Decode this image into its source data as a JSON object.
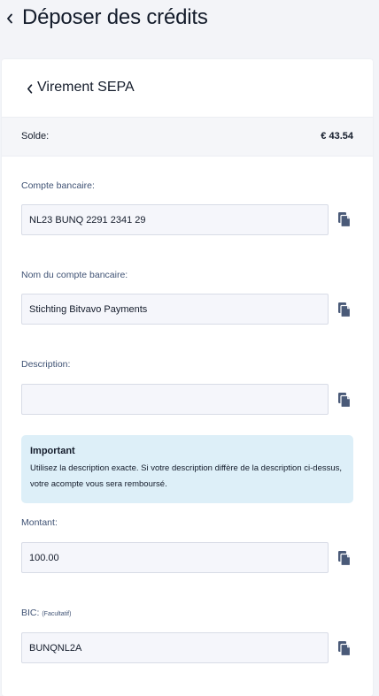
{
  "page": {
    "title": "Déposer des crédits"
  },
  "card": {
    "title": "Virement SEPA"
  },
  "balance": {
    "label": "Solde:",
    "value": "€ 43.54"
  },
  "fields": {
    "iban": {
      "label": "Compte bancaire:",
      "value": "NL23 BUNQ 2291 2341 29"
    },
    "account_name": {
      "label": "Nom du compte bancaire:",
      "value": "Stichting Bitvavo Payments"
    },
    "description": {
      "label": "Description:",
      "value": ""
    },
    "amount": {
      "label": "Montant:",
      "value": "100.00"
    },
    "bic": {
      "label": "BIC:",
      "optional_note": "(Facultatif)",
      "value": "BUNQNL2A"
    }
  },
  "notice": {
    "title": "Important",
    "text": "Utilisez la description exacte. Si votre description diffère de la description ci-dessus, votre acompte vous sera remboursé."
  },
  "colors": {
    "background": "#f3f4f8",
    "card": "#ffffff",
    "input_background": "#f5f6fb",
    "notice_background": "#ddeff8",
    "label": "#3f5274",
    "text": "#141c2b"
  },
  "icons": {
    "back": "chevron-left-icon",
    "copy": "copy-icon"
  }
}
